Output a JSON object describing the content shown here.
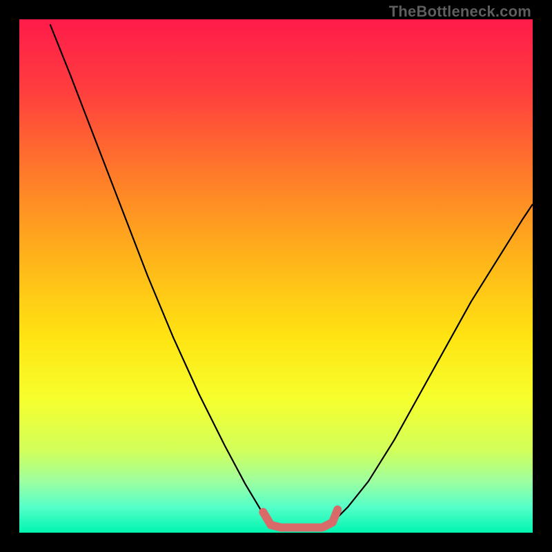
{
  "watermark": "TheBottleneck.com",
  "chart_data": {
    "type": "line",
    "title": "",
    "xlabel": "",
    "ylabel": "",
    "xlim": [
      0,
      100
    ],
    "ylim": [
      0,
      100
    ],
    "background_gradient": {
      "stops": [
        {
          "offset": 0.0,
          "color": "#ff1b4a"
        },
        {
          "offset": 0.14,
          "color": "#ff3e3e"
        },
        {
          "offset": 0.3,
          "color": "#ff7a2a"
        },
        {
          "offset": 0.46,
          "color": "#ffb21a"
        },
        {
          "offset": 0.62,
          "color": "#ffe412"
        },
        {
          "offset": 0.74,
          "color": "#f6ff2e"
        },
        {
          "offset": 0.84,
          "color": "#d2ff5a"
        },
        {
          "offset": 0.9,
          "color": "#9effa0"
        },
        {
          "offset": 0.95,
          "color": "#55ffc9"
        },
        {
          "offset": 1.0,
          "color": "#00f5b0"
        }
      ]
    },
    "series": [
      {
        "name": "bottleneck-curve",
        "color": "#000000",
        "width": 2.2,
        "points": [
          {
            "x": 6.0,
            "y": 99.0
          },
          {
            "x": 10.0,
            "y": 89.0
          },
          {
            "x": 15.0,
            "y": 76.0
          },
          {
            "x": 20.0,
            "y": 63.0
          },
          {
            "x": 25.0,
            "y": 50.0
          },
          {
            "x": 30.0,
            "y": 38.0
          },
          {
            "x": 35.0,
            "y": 27.0
          },
          {
            "x": 40.0,
            "y": 17.0
          },
          {
            "x": 44.0,
            "y": 9.5
          },
          {
            "x": 47.0,
            "y": 4.5
          },
          {
            "x": 49.0,
            "y": 2.0
          },
          {
            "x": 51.0,
            "y": 1.0
          },
          {
            "x": 55.0,
            "y": 1.0
          },
          {
            "x": 59.0,
            "y": 1.0
          },
          {
            "x": 61.0,
            "y": 2.0
          },
          {
            "x": 64.0,
            "y": 5.0
          },
          {
            "x": 68.0,
            "y": 10.0
          },
          {
            "x": 73.0,
            "y": 18.0
          },
          {
            "x": 78.0,
            "y": 27.0
          },
          {
            "x": 83.0,
            "y": 36.0
          },
          {
            "x": 88.0,
            "y": 45.0
          },
          {
            "x": 93.0,
            "y": 53.0
          },
          {
            "x": 98.0,
            "y": 61.0
          },
          {
            "x": 100.0,
            "y": 64.0
          }
        ]
      },
      {
        "name": "optimal-band-marker",
        "color": "#d86a6a",
        "width": 12,
        "linecap": "round",
        "points": [
          {
            "x": 47.5,
            "y": 4.0
          },
          {
            "x": 49.0,
            "y": 1.5
          },
          {
            "x": 51.0,
            "y": 1.0
          },
          {
            "x": 55.0,
            "y": 1.0
          },
          {
            "x": 59.0,
            "y": 1.0
          },
          {
            "x": 61.0,
            "y": 2.0
          },
          {
            "x": 62.0,
            "y": 4.5
          }
        ]
      }
    ],
    "markers": [
      {
        "name": "optimal-start-dot",
        "x": 47.5,
        "y": 4.0,
        "r": 6,
        "color": "#d86a6a"
      },
      {
        "name": "optimal-end-tick",
        "x": 62.0,
        "y": 4.5,
        "r": 4,
        "color": "#d86a6a"
      }
    ]
  }
}
